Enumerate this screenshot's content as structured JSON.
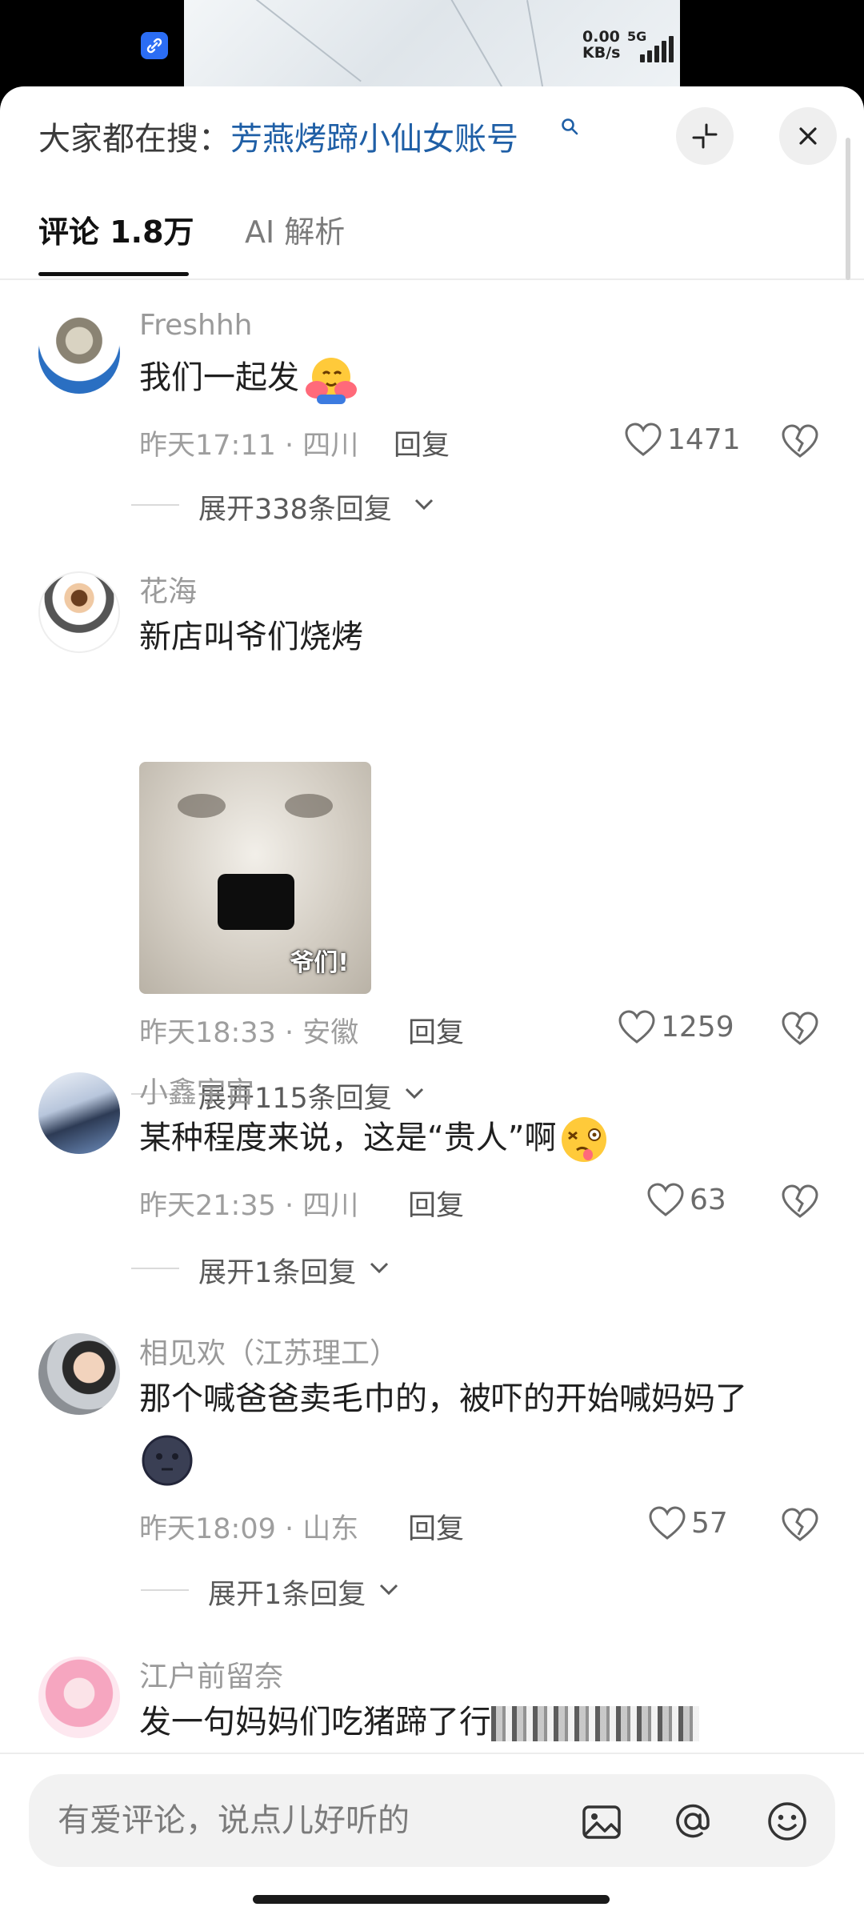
{
  "status_bar": {
    "net_speed": "0.00",
    "net_unit": "KB/s",
    "network_type": "5G"
  },
  "header": {
    "hot_search_prefix": "大家都在搜：",
    "hot_search_term": "芳燕烤蹄小仙女账号"
  },
  "tabs": [
    {
      "label": "评论 1.8万",
      "active": true
    },
    {
      "label": "AI 解析",
      "active": false
    }
  ],
  "comments": [
    {
      "username": "Freshhh",
      "text": "我们一起发",
      "emoji": "hugging-face",
      "time": "昨天17:11",
      "location": "四川",
      "reply_label": "回复",
      "likes": "1471",
      "expand_label": "展开338条回复"
    },
    {
      "username": "花海",
      "text": "新店叫爷们烧烤",
      "sticker_caption": "爷们!",
      "time": "昨天18:33",
      "location": "安徽",
      "reply_label": "回复",
      "likes": "1259",
      "expand_label": "展开115条回复"
    },
    {
      "username": "小鑫宇宙",
      "text": "某种程度来说，这是“贵人”啊",
      "emoji": "woozy-face",
      "time": "昨天21:35",
      "location": "四川",
      "reply_label": "回复",
      "likes": "63",
      "expand_label": "展开1条回复"
    },
    {
      "username": "相见欢（江苏理工）",
      "text": "那个喊爸爸卖毛巾的，被吓的开始喊妈妈了",
      "emoji": "new-moon-face",
      "time": "昨天18:09",
      "location": "山东",
      "reply_label": "回复",
      "likes": "57",
      "expand_label": "展开1条回复"
    },
    {
      "username": "江户前留奈",
      "text": "发一句妈妈们吃猪蹄了行"
    }
  ],
  "input_bar": {
    "placeholder": "有爱评论，说点儿好听的"
  },
  "meta_separator": "·",
  "colors": {
    "hot_search_term": "#1f5fa6",
    "muted_text": "#9e9e9e",
    "primary_text": "#1f1f1f"
  }
}
